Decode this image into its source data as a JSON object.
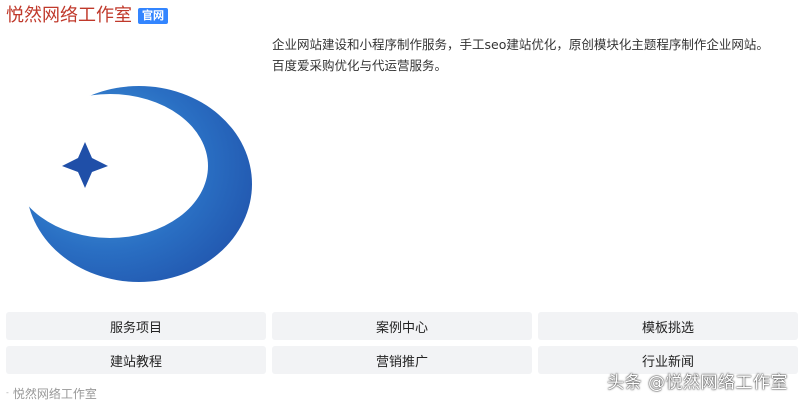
{
  "result": {
    "title": "悦然网络工作室",
    "badge": "官网",
    "logo_icon": "crescent-star-logo",
    "description_lines": [
      "企业网站建设和小程序制作服务，手工seo建站优化，原创模块化主题程序制作企业网站。",
      "百度爱采购优化与代运营服务。"
    ],
    "sitelinks": [
      {
        "label": "服务项目"
      },
      {
        "label": "案例中心"
      },
      {
        "label": "模板挑选"
      },
      {
        "label": "建站教程"
      },
      {
        "label": "营销推广"
      },
      {
        "label": "行业新闻"
      }
    ],
    "source_icon": "link-icon",
    "source": "悦然网络工作室"
  },
  "watermark": "头条 @悦然网络工作室",
  "colors": {
    "title": "#c0392b",
    "badge_bg": "#3385ff",
    "logo_dark_blue": "#1f4fa8",
    "logo_light_blue": "#4aa3df",
    "sitelink_bg": "#f2f3f5",
    "source_text": "#999999"
  }
}
